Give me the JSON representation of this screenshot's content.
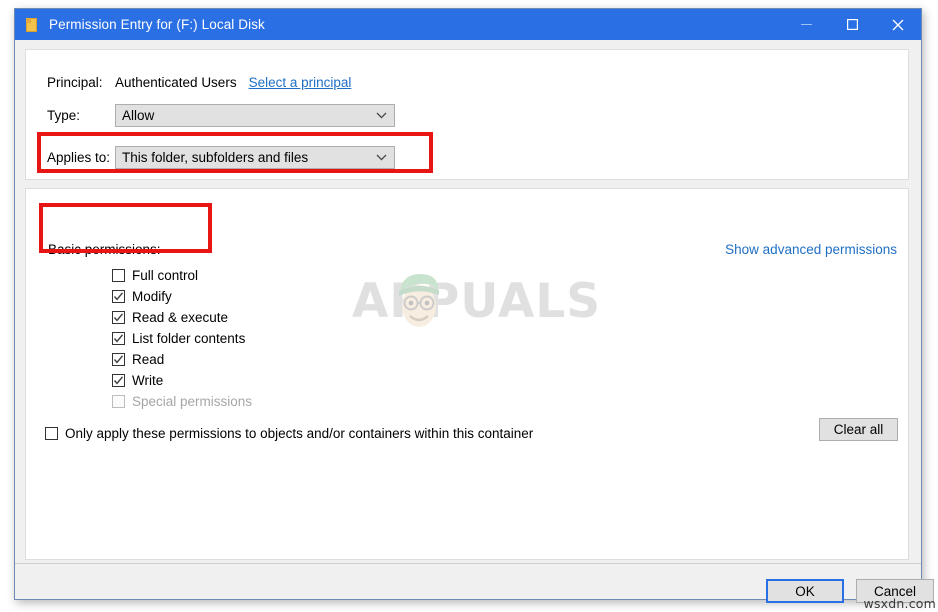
{
  "window": {
    "title": "Permission Entry for (F:) Local Disk",
    "icon": "folder-icon",
    "caption": {
      "minimize": "minimize-icon",
      "maximize": "maximize-icon",
      "close": "close-icon"
    },
    "accent_color": "#2a6fe4",
    "border_color": "#6e8bb5"
  },
  "principal": {
    "label": "Principal:",
    "value": "Authenticated Users",
    "link": "Select a principal"
  },
  "type": {
    "label": "Type:",
    "value": "Allow"
  },
  "applies_to": {
    "label": "Applies to:",
    "value": "This folder, subfolders and files"
  },
  "permissions": {
    "section_title": "Basic permissions:",
    "advanced_link": "Show advanced permissions",
    "items": [
      {
        "label": "Full control",
        "checked": false,
        "disabled": false
      },
      {
        "label": "Modify",
        "checked": true,
        "disabled": false
      },
      {
        "label": "Read & execute",
        "checked": true,
        "disabled": false
      },
      {
        "label": "List folder contents",
        "checked": true,
        "disabled": false
      },
      {
        "label": "Read",
        "checked": true,
        "disabled": false
      },
      {
        "label": "Write",
        "checked": true,
        "disabled": false
      },
      {
        "label": "Special permissions",
        "checked": false,
        "disabled": true
      }
    ],
    "only_apply": {
      "label": "Only apply these permissions to objects and/or containers within this container",
      "checked": false
    },
    "clear_all": "Clear all"
  },
  "footer": {
    "ok": "OK",
    "cancel": "Cancel"
  },
  "annotations": {
    "box_color": "#e81515",
    "count": 2
  },
  "watermarks": {
    "center": "PPUALS",
    "center_lead": "A",
    "corner": "wsxdn.com"
  }
}
